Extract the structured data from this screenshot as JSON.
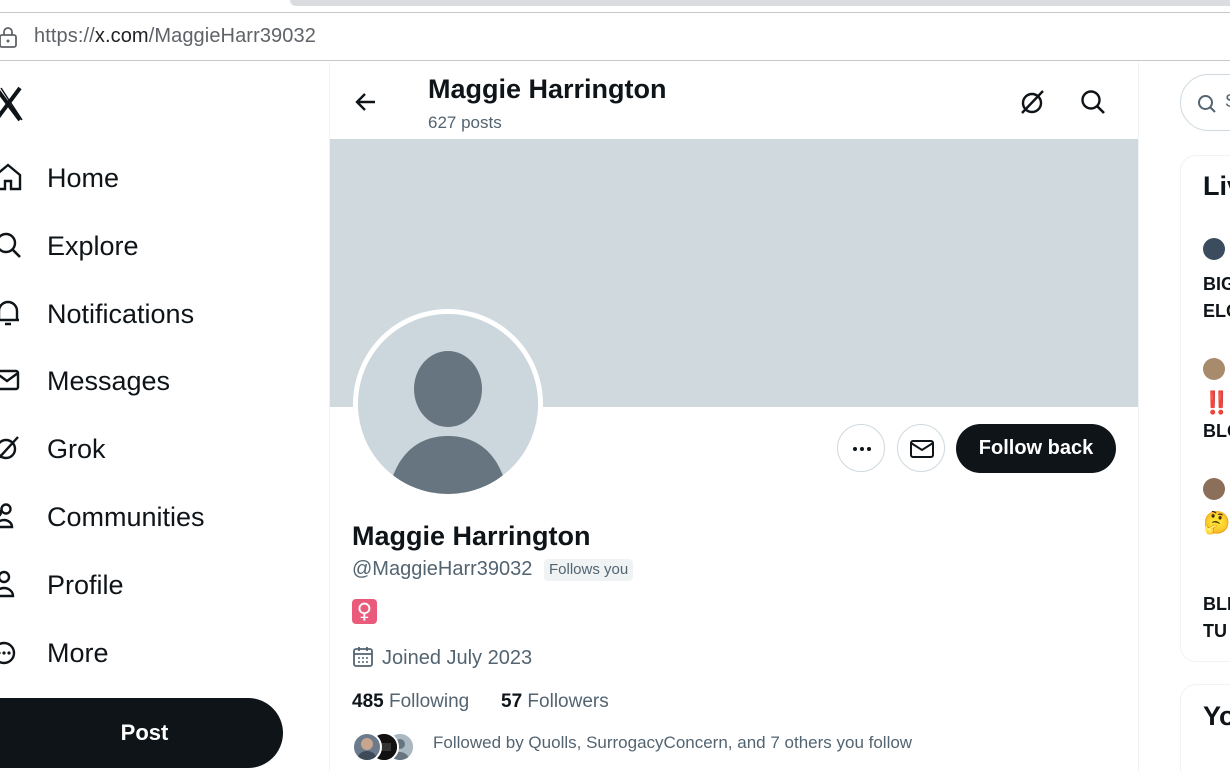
{
  "browser": {
    "url_scheme": "https://",
    "url_host": "x.com",
    "url_path": "/MaggieHarr39032"
  },
  "nav": {
    "items": [
      {
        "label": "Home",
        "icon": "home-icon"
      },
      {
        "label": "Explore",
        "icon": "search-icon"
      },
      {
        "label": "Notifications",
        "icon": "bell-icon"
      },
      {
        "label": "Messages",
        "icon": "envelope-icon"
      },
      {
        "label": "Grok",
        "icon": "grok-icon"
      },
      {
        "label": "Communities",
        "icon": "people-icon"
      },
      {
        "label": "Profile",
        "icon": "person-icon"
      },
      {
        "label": "More",
        "icon": "more-circle-icon"
      }
    ],
    "post_label": "Post"
  },
  "header": {
    "name": "Maggie Harrington",
    "posts": "627 posts"
  },
  "profile": {
    "name": "Maggie Harrington",
    "handle": "@MaggieHarr39032",
    "follows_you": "Follows you",
    "bio_emoji": "♀",
    "joined": "Joined July 2023",
    "following_count": "485",
    "following_label": "Following",
    "followers_count": "57",
    "followers_label": "Followers",
    "followed_by": "Followed by Quolls, SurrogacyConcern, and 7 others you follow",
    "follow_button": "Follow back"
  },
  "right": {
    "search_placeholder": "Se",
    "live_title": "Liv",
    "items": [
      {
        "line1": "BIG",
        "line2": "ELO"
      },
      {
        "line1": "‼️",
        "line2": "BLO"
      },
      {
        "line1": "🤔",
        "line2": ""
      },
      {
        "line1": "BLI",
        "line2": "TU"
      }
    ],
    "you_title": "Yo"
  },
  "colors": {
    "banner": "#cfd9de",
    "text_primary": "#0f1419",
    "text_secondary": "#536471",
    "button_dark": "#0f1419"
  }
}
